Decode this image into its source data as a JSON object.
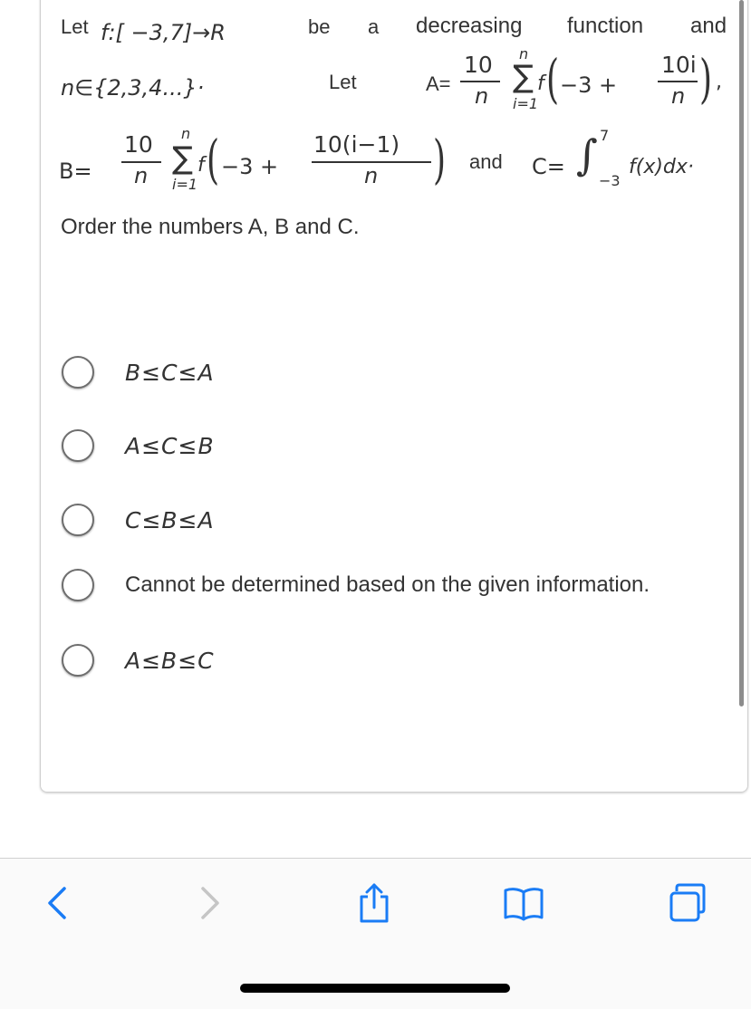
{
  "question": {
    "line1": {
      "let": "Let",
      "f_def": "f:[ −3,7]→R",
      "be": "be",
      "a": "a",
      "decreasing": "decreasing",
      "function": "function",
      "and": "and"
    },
    "line2": {
      "n_set": "n∈{2,3,4...}·",
      "let": "Let",
      "A_eq": "A=",
      "coef_num": "10",
      "coef_den": "n",
      "sum_top": "n",
      "sum_bottom": "i=1",
      "sigma": "∑",
      "f": "f",
      "inner": "−3 +",
      "arg_num": "10i",
      "arg_den": "n",
      "trail": ","
    },
    "line3": {
      "B_eq": "B=",
      "coef_num": "10",
      "coef_den": "n",
      "sum_top": "n",
      "sum_bottom": "i=1",
      "sigma": "∑",
      "f": "f",
      "inner": "−3 +",
      "arg_num": "10(i−1)",
      "arg_den": "n",
      "and": "and",
      "C_eq": "C=",
      "integral": "∫",
      "upper": "7",
      "lower": "−3",
      "integrand": "f(x)dx·"
    },
    "prompt": "Order the numbers A, B and C."
  },
  "options": [
    {
      "label": "B≤C≤A",
      "selected": false
    },
    {
      "label": "A≤C≤B",
      "selected": false
    },
    {
      "label": "C≤B≤A",
      "selected": false
    },
    {
      "label": "Cannot be determined based on the given information.",
      "selected": false
    },
    {
      "label": "A≤B≤C",
      "selected": false
    }
  ],
  "toolbar": {
    "back": "back-icon",
    "forward": "forward-icon",
    "share": "share-icon",
    "bookmarks": "bookmarks-icon",
    "tabs": "tabs-icon"
  }
}
